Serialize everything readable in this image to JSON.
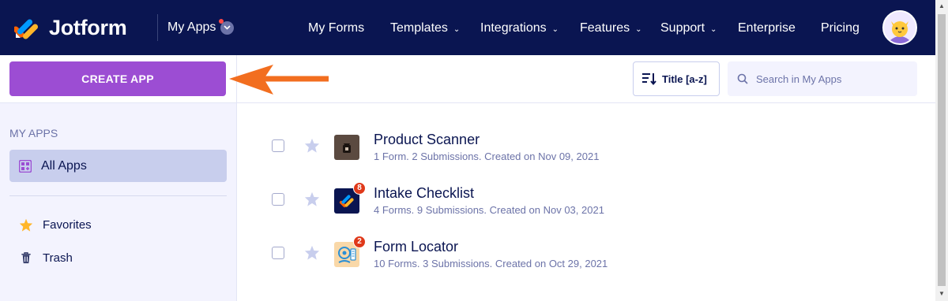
{
  "brand": {
    "name": "Jotform"
  },
  "header": {
    "switcher_label": "My Apps",
    "nav": [
      {
        "label": "My Forms",
        "dropdown": false
      },
      {
        "label": "Templates",
        "dropdown": true
      },
      {
        "label": "Integrations",
        "dropdown": true
      },
      {
        "label": "Features",
        "dropdown": true
      },
      {
        "label": "Support",
        "dropdown": true
      },
      {
        "label": "Enterprise",
        "dropdown": false
      },
      {
        "label": "Pricing",
        "dropdown": false
      }
    ]
  },
  "sidebar": {
    "create_label": "CREATE APP",
    "section_title": "MY APPS",
    "all_apps_label": "All Apps",
    "favorites_label": "Favorites",
    "trash_label": "Trash"
  },
  "toolbar": {
    "sort_label": "Title [a-z]",
    "search_placeholder": "Search in My Apps"
  },
  "apps": [
    {
      "title": "Product Scanner",
      "meta": "1 Form. 2 Submissions. Created on Nov 09, 2021",
      "badge": "",
      "icon": "package-icon"
    },
    {
      "title": "Intake Checklist",
      "meta": "4 Forms. 9 Submissions. Created on Nov 03, 2021",
      "badge": "8",
      "icon": "jotform-logo-icon"
    },
    {
      "title": "Form Locator",
      "meta": "10 Forms. 3 Submissions. Created on Oct 29, 2021",
      "badge": "2",
      "icon": "map-pin-icon"
    }
  ],
  "colors": {
    "navy": "#0a1551",
    "purple": "#9c4dd3",
    "arrow_orange": "#f26e1f",
    "badge_red": "#e0391a"
  }
}
